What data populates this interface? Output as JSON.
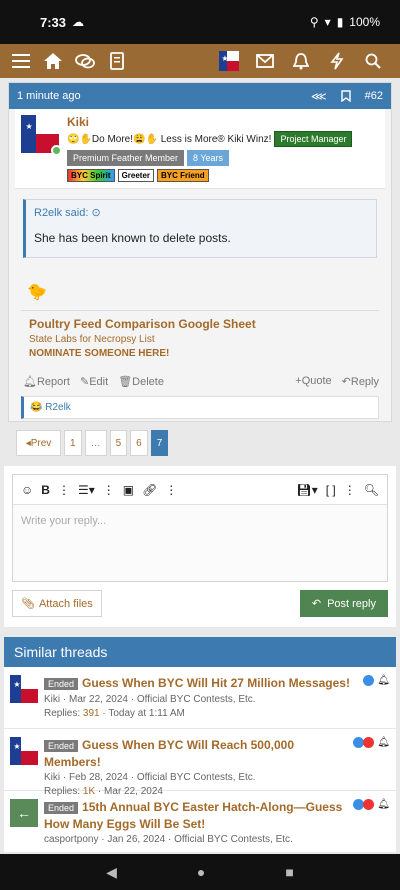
{
  "status": {
    "time": "7:33",
    "battery": "100%"
  },
  "post": {
    "timestamp": "1 minute ago",
    "post_number": "#62",
    "author": "Kiki",
    "signature_text": "🙄✋Do More!😩✋ Less is More® Kiki Winz!",
    "role_badge": "Project Manager",
    "title_badge": "Premium Feather Member",
    "years_badge": "8 Years",
    "mini_badges": [
      "BYC Spirit",
      "Greeter",
      "BYC Friend"
    ],
    "quote_author": "R2elk said:",
    "quote_body": "She has been known to delete posts.",
    "sig_line1": "Poultry Feed Comparison Google Sheet",
    "sig_line2": "State Labs for Necropsy List",
    "sig_line3": "NOMINATE SOMEONE HERE!",
    "actions": {
      "report": "Report",
      "edit": "Edit",
      "delete": "Delete",
      "quote": "Quote",
      "reply": "Reply"
    },
    "reaction_user": "R2elk"
  },
  "pager": {
    "prev": "Prev",
    "pages": [
      "1",
      "…",
      "5",
      "6",
      "7"
    ],
    "active": "7"
  },
  "editor": {
    "placeholder": "Write your reply...",
    "attach": "Attach files",
    "post_reply": "Post reply"
  },
  "similar": {
    "heading": "Similar threads",
    "threads": [
      {
        "prefix": "Ended",
        "title": "Guess When BYC Will Hit 27 Million Messages!",
        "author": "Kiki",
        "date": "Mar 22, 2024",
        "forum": "Official BYC Contests, Etc.",
        "replies_label": "Replies:",
        "replies": "391",
        "last": "Today at 1:11 AM"
      },
      {
        "prefix": "Ended",
        "title": "Guess When BYC Will Reach 500,000 Members!",
        "author": "Kiki",
        "date": "Feb 28, 2024",
        "forum": "Official BYC Contests, Etc.",
        "replies_label": "Replies:",
        "replies": "1K",
        "last": "Mar 22, 2024"
      },
      {
        "prefix": "Ended",
        "title": "15th Annual BYC Easter Hatch-Along—Guess How Many Eggs Will Be Set!",
        "author": "casportpony",
        "date": "Jan 26, 2024",
        "forum": "Official BYC Contests, Etc.",
        "replies_label": "",
        "replies": "",
        "last": ""
      }
    ]
  },
  "colors": {
    "nav": "#9a6a34",
    "accent": "#3d7ab0",
    "link": "#a36a2a",
    "post_button": "#4f8550"
  }
}
